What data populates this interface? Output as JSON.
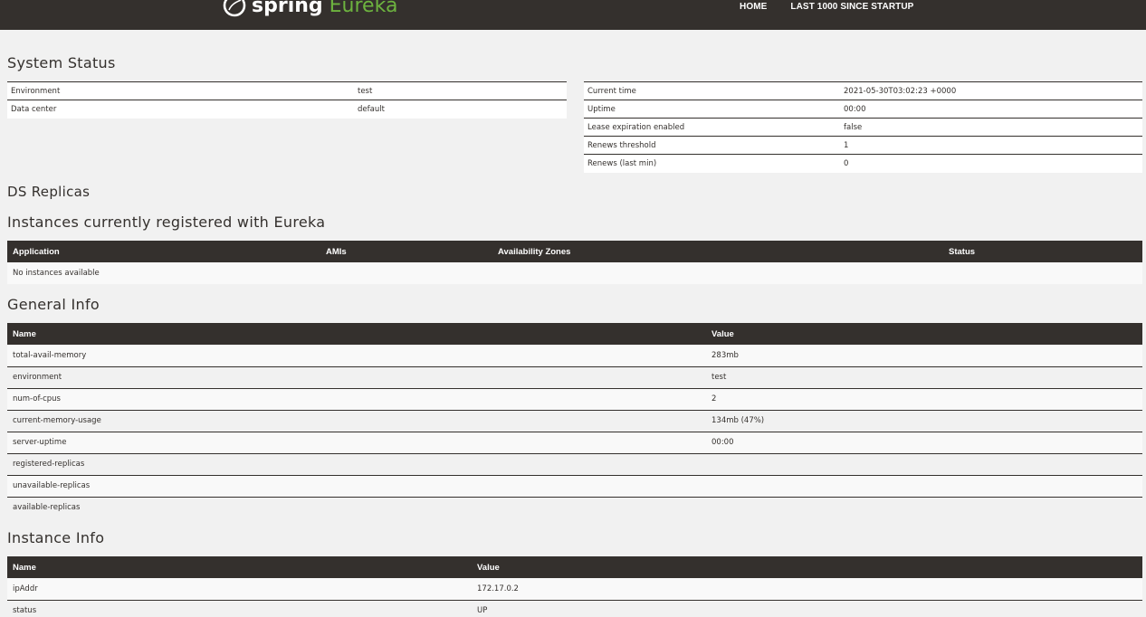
{
  "nav": {
    "brand_spring": "spring",
    "brand_eureka": "Eureka",
    "links": [
      "HOME",
      "LAST 1000 SINCE STARTUP"
    ]
  },
  "system_status": {
    "title": "System Status",
    "left": [
      {
        "key": "Environment",
        "value": "test"
      },
      {
        "key": "Data center",
        "value": "default"
      }
    ],
    "right": [
      {
        "key": "Current time",
        "value": "2021-05-30T03:02:23 +0000"
      },
      {
        "key": "Uptime",
        "value": "00:00"
      },
      {
        "key": "Lease expiration enabled",
        "value": "false"
      },
      {
        "key": "Renews threshold",
        "value": "1"
      },
      {
        "key": "Renews (last min)",
        "value": "0"
      }
    ]
  },
  "ds_replicas": {
    "title": "DS Replicas"
  },
  "instances": {
    "title": "Instances currently registered with Eureka",
    "columns": [
      "Application",
      "AMIs",
      "Availability Zones",
      "Status"
    ],
    "empty_text": "No instances available"
  },
  "general_info": {
    "title": "General Info",
    "columns": [
      "Name",
      "Value"
    ],
    "rows": [
      {
        "name": "total-avail-memory",
        "value": "283mb"
      },
      {
        "name": "environment",
        "value": "test"
      },
      {
        "name": "num-of-cpus",
        "value": "2"
      },
      {
        "name": "current-memory-usage",
        "value": "134mb (47%)"
      },
      {
        "name": "server-uptime",
        "value": "00:00"
      },
      {
        "name": "registered-replicas",
        "value": ""
      },
      {
        "name": "unavailable-replicas",
        "value": ""
      },
      {
        "name": "available-replicas",
        "value": ""
      }
    ]
  },
  "instance_info": {
    "title": "Instance Info",
    "columns": [
      "Name",
      "Value"
    ],
    "rows": [
      {
        "name": "ipAddr",
        "value": "172.17.0.2"
      },
      {
        "name": "status",
        "value": "UP"
      }
    ]
  },
  "colors": {
    "dark": "#34302d",
    "brand_green": "#6db33f",
    "background": "#f1f1f1"
  }
}
